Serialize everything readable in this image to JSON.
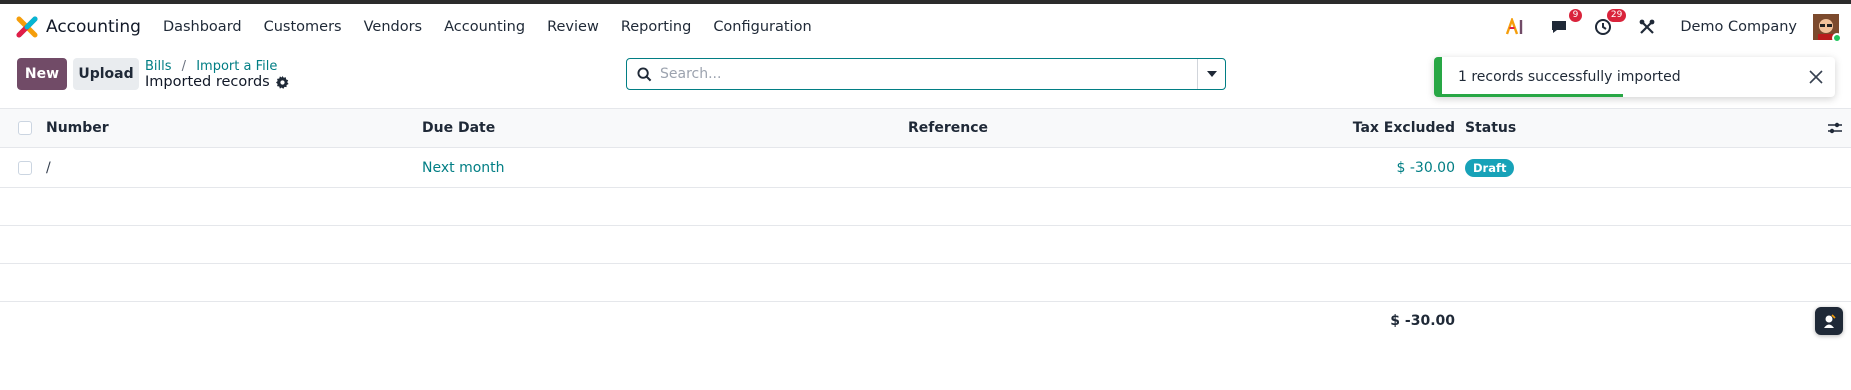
{
  "app": {
    "name": "Accounting"
  },
  "nav": {
    "menu": [
      "Dashboard",
      "Customers",
      "Vendors",
      "Accounting",
      "Review",
      "Reporting",
      "Configuration"
    ],
    "messages_count": "9",
    "activities_count": "29",
    "company": "Demo Company"
  },
  "control": {
    "new_label": "New",
    "upload_label": "Upload",
    "breadcrumb": [
      "Bills",
      "Import a File"
    ],
    "breadcrumb_sep": "/",
    "current": "Imported records"
  },
  "search": {
    "placeholder": "Search...",
    "value": ""
  },
  "toast": {
    "message": "1 records successfully imported",
    "progress": 0.46
  },
  "table": {
    "columns": {
      "number": "Number",
      "due_date": "Due Date",
      "reference": "Reference",
      "tax_excluded": "Tax Excluded",
      "status": "Status"
    },
    "rows": [
      {
        "number": "/",
        "due_date": "Next month",
        "reference": "",
        "tax_excluded": "$ -30.00",
        "status": "Draft"
      }
    ],
    "total": "$ -30.00"
  },
  "colors": {
    "primary": "#714b67",
    "link": "#017e84",
    "success": "#28a745",
    "badge": "#d9233b",
    "draft": "#17a2b8"
  },
  "icons": [
    "app-logo-icon",
    "ai-icon",
    "chat-icon",
    "clock-icon",
    "tools-icon",
    "gear-icon",
    "search-icon",
    "caret-down-icon",
    "close-icon",
    "column-options-icon",
    "assistant-icon"
  ]
}
